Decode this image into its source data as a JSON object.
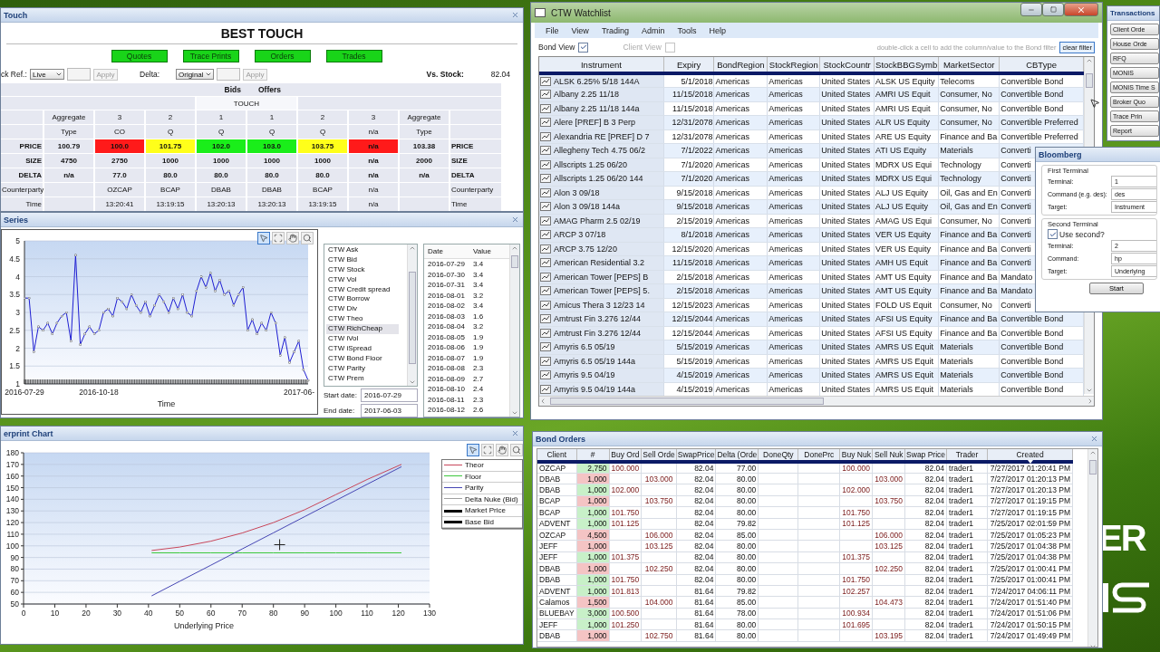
{
  "best_touch": {
    "title": "Touch",
    "heading": "BEST TOUCH",
    "buttons": [
      "Quotes",
      "Trace Prints",
      "Orders",
      "Trades"
    ],
    "stock_ref": {
      "label": "ck Ref.:",
      "value": "Live"
    },
    "delta": {
      "label": "Delta:",
      "value": "Original"
    },
    "apply_buttons": [
      {
        "label": "Apply",
        "disabled": true
      },
      {
        "label": "Apply",
        "disabled": true
      }
    ],
    "vs_stock": {
      "label": "Vs. Stock:",
      "value": "82.04"
    },
    "groups": [
      "Bids",
      "Offers"
    ],
    "band": "TOUCH",
    "rows": [
      {
        "kind": "text",
        "cells": [
          {},
          {
            "text": "Aggregate"
          },
          {
            "text": "3"
          },
          {
            "text": "2"
          },
          {
            "text": "1"
          },
          {
            "text": "1"
          },
          {
            "text": "2"
          },
          {
            "text": "3"
          },
          {
            "text": "Aggregate"
          },
          {}
        ]
      },
      {
        "kind": "text",
        "cells": [
          {},
          {
            "text": "Type"
          },
          {
            "text": "CO"
          },
          {
            "text": "Q"
          },
          {
            "text": "Q"
          },
          {
            "text": "Q"
          },
          {
            "text": "Q"
          },
          {
            "text": "n/a"
          },
          {
            "text": "Type"
          },
          {}
        ]
      },
      {
        "kind": "figure",
        "cells": [
          {
            "text": "PRICE"
          },
          {
            "text": "100.79"
          },
          {
            "text": "100.0",
            "color": "#ff1a1a"
          },
          {
            "text": "101.75",
            "color": "#ffff1a"
          },
          {
            "text": "102.0",
            "color": "#1aee1a"
          },
          {
            "text": "103.0",
            "color": "#1aee1a"
          },
          {
            "text": "103.75",
            "color": "#ffff1a"
          },
          {
            "text": "n/a",
            "color": "#ff1a1a"
          },
          {
            "text": "103.38"
          },
          {
            "text": "PRICE"
          }
        ]
      },
      {
        "kind": "figure",
        "cells": [
          {
            "text": "SIZE"
          },
          {
            "text": "4750"
          },
          {
            "text": "2750"
          },
          {
            "text": "1000"
          },
          {
            "text": "1000"
          },
          {
            "text": "1000"
          },
          {
            "text": "1000"
          },
          {
            "text": "n/a"
          },
          {
            "text": "2000"
          },
          {
            "text": "SIZE"
          }
        ]
      },
      {
        "kind": "figure",
        "cells": [
          {
            "text": "DELTA"
          },
          {
            "text": "n/a"
          },
          {
            "text": "77.0"
          },
          {
            "text": "80.0"
          },
          {
            "text": "80.0"
          },
          {
            "text": "80.0"
          },
          {
            "text": "80.0"
          },
          {
            "text": "n/a"
          },
          {
            "text": "n/a"
          },
          {
            "text": "DELTA"
          }
        ]
      },
      {
        "kind": "text",
        "cells": [
          {
            "text": "Counterparty"
          },
          {},
          {
            "text": "OZCAP"
          },
          {
            "text": "BCAP"
          },
          {
            "text": "DBAB"
          },
          {
            "text": "DBAB"
          },
          {
            "text": "BCAP"
          },
          {
            "text": "n/a"
          },
          {},
          {
            "text": "Counterparty"
          }
        ]
      },
      {
        "kind": "text",
        "cells": [
          {
            "text": "Time"
          },
          {},
          {
            "text": "13:20:41"
          },
          {
            "text": "13:19:15"
          },
          {
            "text": "13:20:13"
          },
          {
            "text": "13:20:13"
          },
          {
            "text": "13:19:15"
          },
          {
            "text": "n/a"
          },
          {},
          {
            "text": "Time"
          }
        ]
      }
    ]
  },
  "series_window": {
    "title": "Series",
    "toolbar": [
      {
        "kind": "pointer",
        "selected": true
      },
      {
        "kind": "zoom_box",
        "selected": false
      },
      {
        "kind": "pan",
        "selected": false
      },
      {
        "kind": "zoom",
        "selected": false
      }
    ],
    "chart_data": {
      "type": "line",
      "xlabel": "Time",
      "grid": true,
      "ylim": [
        1,
        5
      ],
      "yticks": [
        1,
        1.5,
        2,
        2.5,
        3,
        3.5,
        4,
        4.5,
        5
      ],
      "categories": [
        "2016-07-29",
        null,
        null,
        null,
        null,
        null,
        null,
        null,
        null,
        null,
        null,
        null,
        null,
        null,
        null,
        null,
        "2016-10-18",
        null,
        null,
        null,
        null,
        null,
        null,
        null,
        null,
        null,
        null,
        null,
        null,
        null,
        null,
        null,
        null,
        null,
        null,
        null,
        null,
        null,
        null,
        null,
        null,
        null,
        null,
        null,
        null,
        null,
        null,
        null,
        null,
        null,
        null,
        null,
        null,
        null,
        null,
        null,
        null,
        null,
        null,
        null,
        null,
        "2017-06-"
      ],
      "series": [
        {
          "color": "#1e1ed2",
          "values": [
            3.4,
            3.4,
            1.9,
            2.6,
            2.5,
            2.7,
            2.4,
            2.7,
            2.9,
            3.0,
            2.2,
            4.6,
            2.1,
            2.4,
            2.6,
            2.4,
            2.5,
            3.0,
            3.1,
            2.9,
            3.4,
            3.3,
            3.1,
            3.5,
            3.2,
            3.0,
            3.3,
            2.9,
            3.2,
            3.5,
            3.3,
            3.0,
            3.4,
            3.1,
            3.5,
            3.0,
            2.9,
            3.6,
            4.0,
            3.7,
            4.1,
            3.6,
            3.9,
            3.5,
            3.6,
            3.2,
            3.5,
            3.7,
            2.5,
            2.8,
            2.4,
            2.7,
            2.5,
            3.0,
            2.7,
            1.8,
            2.3,
            1.6,
            1.9,
            2.2,
            1.4,
            1.1
          ]
        }
      ]
    },
    "list": [
      {
        "label": "CTW Ask",
        "selected": false
      },
      {
        "label": "CTW Bid",
        "selected": false
      },
      {
        "label": "CTW Stock",
        "selected": false
      },
      {
        "label": "CTW Vol",
        "selected": false
      },
      {
        "label": "CTW Credit spread",
        "selected": false
      },
      {
        "label": "CTW Borrow",
        "selected": false
      },
      {
        "label": "CTW Div",
        "selected": false
      },
      {
        "label": "CTW Theo",
        "selected": false
      },
      {
        "label": "CTW RichCheap",
        "selected": true
      },
      {
        "label": "CTW iVol",
        "selected": false
      },
      {
        "label": "CTW iSpread",
        "selected": false
      },
      {
        "label": "CTW Bond Floor",
        "selected": false
      },
      {
        "label": "CTW Parity",
        "selected": false
      },
      {
        "label": "CTW Prem",
        "selected": false
      }
    ],
    "start_date": {
      "label": "Start date:",
      "value": "2016-07-29"
    },
    "end_date": {
      "label": "End date:",
      "value": "2017-06-03"
    },
    "table": {
      "columns": [
        "Date",
        "Value"
      ],
      "rows": [
        [
          "2016-07-29",
          "3.4"
        ],
        [
          "2016-07-30",
          "3.4"
        ],
        [
          "2016-07-31",
          "3.4"
        ],
        [
          "2016-08-01",
          "3.2"
        ],
        [
          "2016-08-02",
          "3.4"
        ],
        [
          "2016-08-03",
          "1.6"
        ],
        [
          "2016-08-04",
          "3.2"
        ],
        [
          "2016-08-05",
          "1.9"
        ],
        [
          "2016-08-06",
          "1.9"
        ],
        [
          "2016-08-07",
          "1.9"
        ],
        [
          "2016-08-08",
          "2.3"
        ],
        [
          "2016-08-09",
          "2.7"
        ],
        [
          "2016-08-10",
          "2.4"
        ],
        [
          "2016-08-11",
          "2.3"
        ],
        [
          "2016-08-12",
          "2.6"
        ]
      ]
    }
  },
  "footprint_window": {
    "title": "erprint Chart",
    "toolbar": [
      {
        "kind": "pointer",
        "selected": true
      },
      {
        "kind": "zoom_box",
        "selected": false
      },
      {
        "kind": "pan",
        "selected": false
      },
      {
        "kind": "zoom",
        "selected": false
      }
    ],
    "legend": [
      {
        "name": "Theor",
        "color": "#c8465a",
        "kind": "thin"
      },
      {
        "name": "Floor",
        "color": "#3cc83c",
        "kind": "thin"
      },
      {
        "name": "Parity",
        "color": "#4646b4",
        "kind": "thin"
      },
      {
        "name": "Delta Nuke (Bid)",
        "color": "#a0a0a0",
        "kind": "thin"
      },
      {
        "name": "Market Price",
        "color": "#000000",
        "kind": "thick"
      },
      {
        "name": "Base Bid",
        "color": "#000000",
        "kind": "thick"
      }
    ],
    "chart_data": {
      "type": "line",
      "xlabel": "Underlying Price",
      "grid": true,
      "x": [
        41,
        50,
        60,
        70,
        80,
        90,
        100,
        110,
        121
      ],
      "xlim": [
        0,
        130
      ],
      "ylim": [
        50,
        180
      ],
      "xticks": [
        0,
        10,
        20,
        30,
        40,
        50,
        60,
        70,
        80,
        90,
        100,
        110,
        120,
        130
      ],
      "yticks": [
        50,
        60,
        70,
        80,
        90,
        100,
        110,
        120,
        130,
        140,
        150,
        160,
        170,
        180
      ],
      "series": [
        {
          "color": "#c8465a",
          "values": [
            96,
            99,
            104,
            111,
            120,
            131,
            144,
            157,
            170
          ]
        },
        {
          "color": "#3cc83c",
          "values": [
            94,
            94,
            94,
            94,
            94,
            94,
            94,
            94,
            94
          ]
        },
        {
          "color": "#4646b4",
          "values": [
            57,
            69.5,
            83.4,
            97.3,
            111.2,
            125.1,
            139,
            152.9,
            168
          ]
        }
      ]
    }
  },
  "watchlist": {
    "title": "CTW Watchlist",
    "menu": [
      "File",
      "View",
      "Trading",
      "Admin",
      "Tools",
      "Help"
    ],
    "bond_view": {
      "label": "Bond View",
      "checked": true
    },
    "client_view": {
      "label": "Client View",
      "checked": false,
      "disabled": true
    },
    "hint": "double-click a cell to add the column/value to the Bond filter",
    "clear_filter": "clear filter",
    "columns": [
      "Instrument",
      "Expiry",
      "BondRegion",
      "StockRegion",
      "StockCountr",
      "StockBBGSymb",
      "MarketSector",
      "CBType"
    ],
    "rows": [
      [
        "ALSK 6.25% 5/18 144A",
        "5/1/2018",
        "Americas",
        "Americas",
        "United States",
        "ALSK US Equity",
        "Telecoms",
        "Convertible Bond"
      ],
      [
        "Albany 2.25 11/18",
        "11/15/2018",
        "Americas",
        "Americas",
        "United States",
        "AMRI US Equit",
        "Consumer, No",
        "Convertible Bond"
      ],
      [
        "Albany 2.25 11/18 144a",
        "11/15/2018",
        "Americas",
        "Americas",
        "United States",
        "AMRI US Equit",
        "Consumer, No",
        "Convertible Bond"
      ],
      [
        "Alere [PREF]  B 3 Perp",
        "12/31/2078",
        "Americas",
        "Americas",
        "United States",
        "ALR US Equity",
        "Consumer, No",
        "Convertible Preferred"
      ],
      [
        "Alexandria RE [PREF]  D 7",
        "12/31/2078",
        "Americas",
        "Americas",
        "United States",
        "ARE US Equity",
        "Finance and Ba",
        "Convertible Preferred"
      ],
      [
        "Allegheny Tech 4.75 06/2",
        "7/1/2022",
        "Americas",
        "Americas",
        "United States",
        "ATI US Equity",
        "Materials",
        "Converti"
      ],
      [
        "Allscripts 1.25 06/20",
        "7/1/2020",
        "Americas",
        "Americas",
        "United States",
        "MDRX US Equi",
        "Technology",
        "Converti"
      ],
      [
        "Allscripts 1.25 06/20 144",
        "7/1/2020",
        "Americas",
        "Americas",
        "United States",
        "MDRX US Equi",
        "Technology",
        "Converti"
      ],
      [
        "Alon 3 09/18",
        "9/15/2018",
        "Americas",
        "Americas",
        "United States",
        "ALJ US Equity",
        "Oil, Gas and En",
        "Converti"
      ],
      [
        "Alon 3 09/18 144a",
        "9/15/2018",
        "Americas",
        "Americas",
        "United States",
        "ALJ US Equity",
        "Oil, Gas and En",
        "Converti"
      ],
      [
        "AMAG Pharm 2.5 02/19",
        "2/15/2019",
        "Americas",
        "Americas",
        "United States",
        "AMAG US Equi",
        "Consumer, No",
        "Converti"
      ],
      [
        "ARCP 3 07/18",
        "8/1/2018",
        "Americas",
        "Americas",
        "United States",
        "VER US Equity",
        "Finance and Ba",
        "Converti"
      ],
      [
        "ARCP 3.75 12/20",
        "12/15/2020",
        "Americas",
        "Americas",
        "United States",
        "VER US Equity",
        "Finance and Ba",
        "Converti"
      ],
      [
        "American Residential 3.2",
        "11/15/2018",
        "Americas",
        "Americas",
        "United States",
        "AMH US Equit",
        "Finance and Ba",
        "Converti"
      ],
      [
        "American Tower [PEPS]  B",
        "2/15/2018",
        "Americas",
        "Americas",
        "United States",
        "AMT US Equity",
        "Finance and Ba",
        "Mandato"
      ],
      [
        "American Tower [PEPS] 5.",
        "2/15/2018",
        "Americas",
        "Americas",
        "United States",
        "AMT US Equity",
        "Finance and Ba",
        "Mandato"
      ],
      [
        "Amicus Thera 3 12/23 14",
        "12/15/2023",
        "Americas",
        "Americas",
        "United States",
        "FOLD US Equit",
        "Consumer, No",
        "Converti"
      ],
      [
        "Amtrust Fin 3.276 12/44",
        "12/15/2044",
        "Americas",
        "Americas",
        "United States",
        "AFSI US Equity",
        "Finance and Ba",
        "Convertible Bond"
      ],
      [
        "Amtrust Fin 3.276 12/44",
        "12/15/2044",
        "Americas",
        "Americas",
        "United States",
        "AFSI US Equity",
        "Finance and Ba",
        "Convertible Bond"
      ],
      [
        "Amyris 6.5 05/19",
        "5/15/2019",
        "Americas",
        "Americas",
        "United States",
        "AMRS US Equit",
        "Materials",
        "Convertible Bond"
      ],
      [
        "Amyris 6.5 05/19 144a",
        "5/15/2019",
        "Americas",
        "Americas",
        "United States",
        "AMRS US Equit",
        "Materials",
        "Convertible Bond"
      ],
      [
        "Amyris 9.5 04/19",
        "4/15/2019",
        "Americas",
        "Americas",
        "United States",
        "AMRS US Equit",
        "Materials",
        "Convertible Bond"
      ],
      [
        "Amyris 9.5 04/19 144a",
        "4/15/2019",
        "Americas",
        "Americas",
        "United States",
        "AMRS US Equit",
        "Materials",
        "Convertible Bond"
      ]
    ]
  },
  "bond_orders": {
    "title": "Bond Orders",
    "columns": [
      "Client",
      "#",
      "Buy Ord",
      "Sell Orde",
      "SwapPrice",
      "Delta (Orde",
      "DoneQty",
      "DonePrc",
      "Buy Nuk",
      "Sell Nuk",
      "Swap Price",
      "Trader",
      "Created"
    ],
    "rows": [
      {
        "color": "#c8f0c8",
        "cells": [
          "OZCAP",
          "2,750",
          "100.000",
          null,
          "82.04",
          "77.00",
          null,
          null,
          "100.000",
          null,
          "82.04",
          "trader1",
          "7/27/2017 01:20:41 PM"
        ]
      },
      {
        "color": "#f4c4c4",
        "cells": [
          "DBAB",
          "1,000",
          null,
          "103.000",
          "82.04",
          "80.00",
          null,
          null,
          null,
          "103.000",
          "82.04",
          "trader1",
          "7/27/2017 01:20:13 PM"
        ]
      },
      {
        "color": "#c8f0c8",
        "cells": [
          "DBAB",
          "1,000",
          "102.000",
          null,
          "82.04",
          "80.00",
          null,
          null,
          "102.000",
          null,
          "82.04",
          "trader1",
          "7/27/2017 01:20:13 PM"
        ]
      },
      {
        "color": "#f4c4c4",
        "cells": [
          "BCAP",
          "1,000",
          null,
          "103.750",
          "82.04",
          "80.00",
          null,
          null,
          null,
          "103.750",
          "82.04",
          "trader1",
          "7/27/2017 01:19:15 PM"
        ]
      },
      {
        "color": "#c8f0c8",
        "cells": [
          "BCAP",
          "1,000",
          "101.750",
          null,
          "82.04",
          "80.00",
          null,
          null,
          "101.750",
          null,
          "82.04",
          "trader1",
          "7/27/2017 01:19:15 PM"
        ]
      },
      {
        "color": "#c8f0c8",
        "cells": [
          "ADVENT",
          "1,000",
          "101.125",
          null,
          "82.04",
          "79.82",
          null,
          null,
          "101.125",
          null,
          "82.04",
          "trader1",
          "7/25/2017 02:01:59 PM"
        ]
      },
      {
        "color": "#f4c4c4",
        "cells": [
          "OZCAP",
          "4,500",
          null,
          "106.000",
          "82.04",
          "85.00",
          null,
          null,
          null,
          "106.000",
          "82.04",
          "trader1",
          "7/25/2017 01:05:23 PM"
        ]
      },
      {
        "color": "#f4c4c4",
        "cells": [
          "JEFF",
          "1,000",
          null,
          "103.125",
          "82.04",
          "80.00",
          null,
          null,
          null,
          "103.125",
          "82.04",
          "trader1",
          "7/25/2017 01:04:38 PM"
        ]
      },
      {
        "color": "#c8f0c8",
        "cells": [
          "JEFF",
          "1,000",
          "101.375",
          null,
          "82.04",
          "80.00",
          null,
          null,
          "101.375",
          null,
          "82.04",
          "trader1",
          "7/25/2017 01:04:38 PM"
        ]
      },
      {
        "color": "#f4c4c4",
        "cells": [
          "DBAB",
          "1,000",
          null,
          "102.250",
          "82.04",
          "80.00",
          null,
          null,
          null,
          "102.250",
          "82.04",
          "trader1",
          "7/25/2017 01:00:41 PM"
        ]
      },
      {
        "color": "#c8f0c8",
        "cells": [
          "DBAB",
          "1,000",
          "101.750",
          null,
          "82.04",
          "80.00",
          null,
          null,
          "101.750",
          null,
          "82.04",
          "trader1",
          "7/25/2017 01:00:41 PM"
        ]
      },
      {
        "color": "#c8f0c8",
        "cells": [
          "ADVENT",
          "1,000",
          "101.813",
          null,
          "81.64",
          "79.82",
          null,
          null,
          "102.257",
          null,
          "82.04",
          "trader1",
          "7/24/2017 04:06:11 PM"
        ]
      },
      {
        "color": "#f4c4c4",
        "cells": [
          "Calamos",
          "1,500",
          null,
          "104.000",
          "81.64",
          "85.00",
          null,
          null,
          null,
          "104.473",
          "82.04",
          "trader1",
          "7/24/2017 01:51:40 PM"
        ]
      },
      {
        "color": "#c8f0c8",
        "cells": [
          "BLUEBAY",
          "3,000",
          "100.500",
          null,
          "81.64",
          "78.00",
          null,
          null,
          "100.934",
          null,
          "82.04",
          "trader1",
          "7/24/2017 01:51:06 PM"
        ]
      },
      {
        "color": "#c8f0c8",
        "cells": [
          "JEFF",
          "1,000",
          "101.250",
          null,
          "81.64",
          "80.00",
          null,
          null,
          "101.695",
          null,
          "82.04",
          "trader1",
          "7/24/2017 01:50:15 PM"
        ]
      },
      {
        "color": "#f4c4c4",
        "cells": [
          "DBAB",
          "1,000",
          null,
          "102.750",
          "81.64",
          "80.00",
          null,
          null,
          null,
          "103.195",
          "82.04",
          "trader1",
          "7/24/2017 01:49:49 PM"
        ]
      }
    ]
  },
  "transactions": {
    "title": "Transactions",
    "buttons": [
      "Client Orde",
      "House Orde",
      "RFQ",
      "MONIS",
      "MONIS Time S",
      "Broker Quo",
      "Trace Prin",
      "Report"
    ]
  },
  "bloomberg": {
    "title": "Bloomberg",
    "first": {
      "legend": "First Terminal",
      "fields": [
        {
          "label": "Terminal:",
          "value": "1"
        },
        {
          "label": "Command (e.g. des):",
          "value": "des"
        },
        {
          "label": "Target:",
          "value": "Instrument"
        }
      ]
    },
    "second": {
      "legend": "Second Terminal",
      "use_second": {
        "label": "Use second?",
        "checked": true
      },
      "fields": [
        {
          "label": "Terminal:",
          "value": "2"
        },
        {
          "label": "Command:",
          "value": "hp"
        },
        {
          "label": "Target:",
          "value": "Underlying"
        }
      ]
    },
    "start": "Start"
  },
  "desktop": {
    "logo_text": "ER"
  }
}
